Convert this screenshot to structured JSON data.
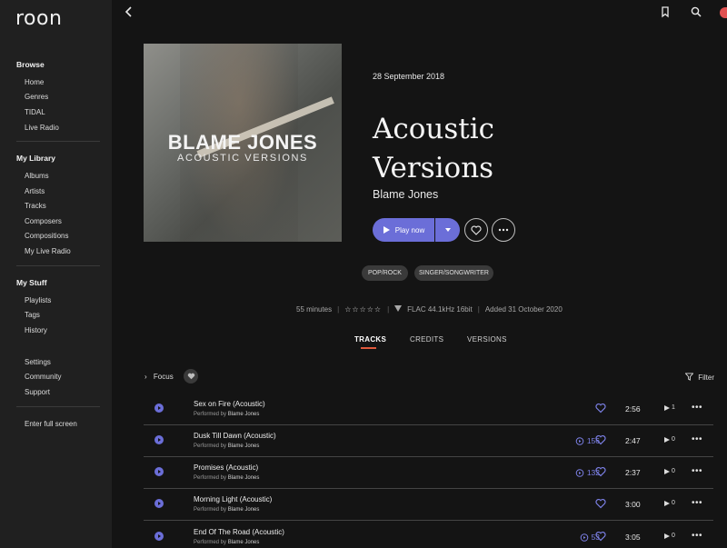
{
  "app": {
    "logo": "roon"
  },
  "colors": {
    "accent": "#6b6ed8",
    "tab_underline": "#e05a3d",
    "background": "#141414",
    "sidebar": "#202020",
    "avatar": "#e05050"
  },
  "sidebar": {
    "sections": [
      {
        "title": "Browse",
        "items": [
          "Home",
          "Genres",
          "TIDAL",
          "Live Radio"
        ]
      },
      {
        "title": "My Library",
        "items": [
          "Albums",
          "Artists",
          "Tracks",
          "Composers",
          "Compositions",
          "My Live Radio"
        ]
      },
      {
        "title": "My Stuff",
        "items": [
          "Playlists",
          "Tags",
          "History"
        ]
      }
    ],
    "extra": [
      "Settings",
      "Community",
      "Support"
    ],
    "fullscreen": "Enter full screen"
  },
  "topbar": {
    "icons": [
      "back-icon",
      "bookmark-icon",
      "search-icon",
      "avatar"
    ]
  },
  "album": {
    "cover_title": "BLAME JONES",
    "cover_subtitle": "ACOUSTIC VERSIONS",
    "release_date": "28 September 2018",
    "title_line1": "Acoustic",
    "title_line2": "Versions",
    "artist": "Blame Jones",
    "play_label": "Play now",
    "tags": [
      "POP/ROCK",
      "SINGER/SONGWRITER"
    ],
    "meta": {
      "duration": "55 minutes",
      "rating": "☆☆☆☆☆",
      "format": "FLAC 44.1kHz 16bit",
      "added": "Added 31 October 2020"
    }
  },
  "tabs": [
    {
      "label": "TRACKS",
      "active": true
    },
    {
      "label": "CREDITS",
      "active": false
    },
    {
      "label": "VERSIONS",
      "active": false
    }
  ],
  "focus_label": "Focus",
  "filter_label": "Filter",
  "performed_by_label": "Performed by",
  "tracks": [
    {
      "title": "Sex on Fire (Acoustic)",
      "performer": "Blame Jones",
      "plays": "",
      "duration": "2:56",
      "count": "1"
    },
    {
      "title": "Dusk Till Dawn (Acoustic)",
      "performer": "Blame Jones",
      "plays": "156",
      "duration": "2:47",
      "count": "0"
    },
    {
      "title": "Promises (Acoustic)",
      "performer": "Blame Jones",
      "plays": "132",
      "duration": "2:37",
      "count": "0"
    },
    {
      "title": "Morning Light (Acoustic)",
      "performer": "Blame Jones",
      "plays": "",
      "duration": "3:00",
      "count": "0"
    },
    {
      "title": "End Of The Road (Acoustic)",
      "performer": "Blame Jones",
      "plays": "53",
      "duration": "3:05",
      "count": "0"
    }
  ]
}
